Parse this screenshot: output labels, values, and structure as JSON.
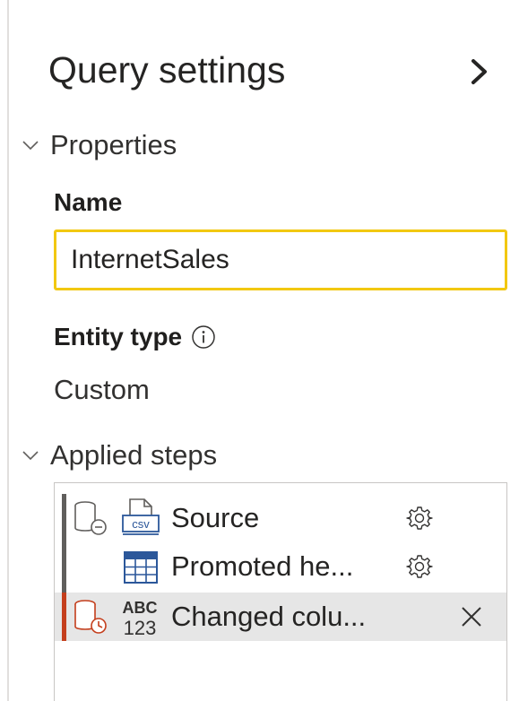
{
  "panel": {
    "title": "Query settings",
    "collapse_icon": "chevron-right-icon"
  },
  "properties": {
    "section_label": "Properties",
    "name_label": "Name",
    "name_value": "InternetSales",
    "entity_type_label": "Entity type",
    "entity_type_value": "Custom"
  },
  "applied_steps": {
    "section_label": "Applied steps",
    "steps": [
      {
        "label": "Source",
        "icon": "csv-file-icon",
        "action_icon": "gear-icon",
        "selected": false
      },
      {
        "label": "Promoted he...",
        "icon": "table-icon",
        "action_icon": "gear-icon",
        "selected": false
      },
      {
        "label": "Changed colu...",
        "icon": "abc-123-type-icon",
        "action_icon": "close-icon",
        "selected": true
      }
    ]
  },
  "colors": {
    "input_focus_border": "#f2c811",
    "step_group_bar": "#605e5c",
    "selected_step_bar": "#c43e1c",
    "selected_step_bg": "#e6e6e6",
    "table_icon_blue": "#2b579a"
  }
}
